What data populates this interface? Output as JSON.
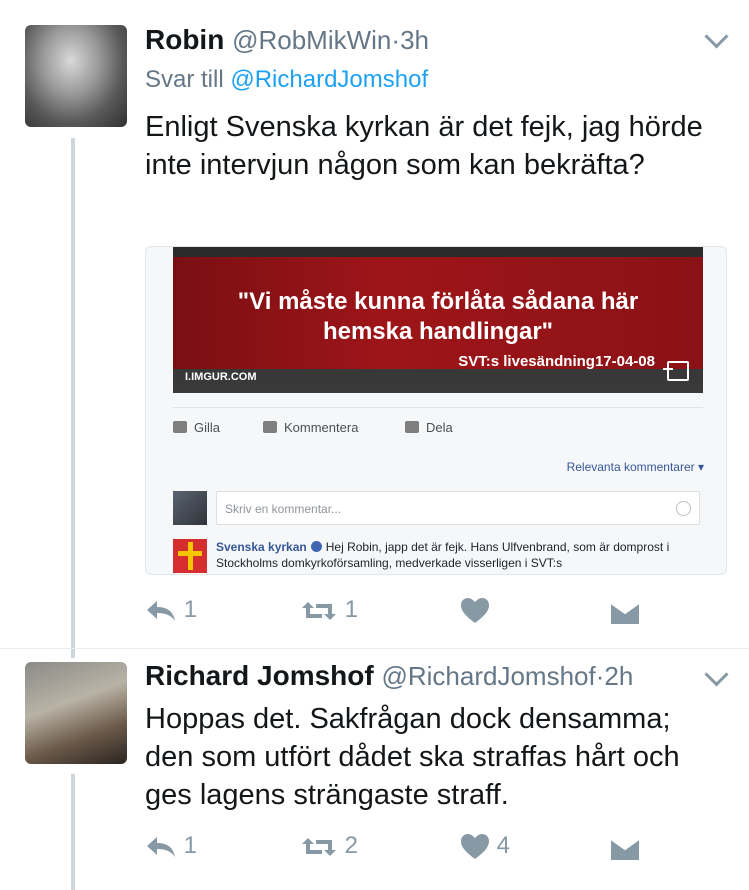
{
  "tweets": [
    {
      "name": "Robin",
      "handle": "@RobMikWin",
      "separator": "·",
      "time": "3h",
      "reply_prefix": "Svar till",
      "reply_to": "@RichardJomshof",
      "text": "Enligt Svenska kyrkan är det fejk, jag hörde inte intervjun någon som kan bekräfta?",
      "actions": {
        "reply": "1",
        "retweet": "1",
        "like": ""
      }
    },
    {
      "name": "Richard Jomshof",
      "handle": "@RichardJomshof",
      "separator": "·",
      "time": "2h",
      "text": "Hoppas det. Sakfrågan dock densamma; den som utfört dådet ska straffas hårt och ges lagens strängaste straff.",
      "actions": {
        "reply": "1",
        "retweet": "2",
        "like": "4"
      }
    }
  ],
  "card": {
    "quote_line1": "\"Vi måste kunna förlåta sådana här",
    "quote_line2": "hemska handlingar\"",
    "caption": "SVT:s livesändning17-04-08",
    "source": "I.IMGUR.COM",
    "fb_actions": {
      "like": "Gilla",
      "comment": "Kommentera",
      "share": "Dela"
    },
    "relevant_comments": "Relevanta kommentarer",
    "comment_placeholder": "Skriv en kommentar...",
    "comment_author": "Svenska kyrkan",
    "comment_text": "Hej Robin, japp det är fejk. Hans Ulfvenbrand, som är domprost i Stockholms domkyrkoförsamling, medverkade visserligen i SVT:s"
  },
  "colors": {
    "link": "#1da1f2",
    "icon": "#8899a6",
    "thread_line": "#ccd6dd"
  },
  "icons": [
    "chevron-down-icon",
    "reply-icon",
    "retweet-icon",
    "heart-icon",
    "dm-icon",
    "external-link-icon",
    "verified-icon",
    "emoji-icon"
  ]
}
